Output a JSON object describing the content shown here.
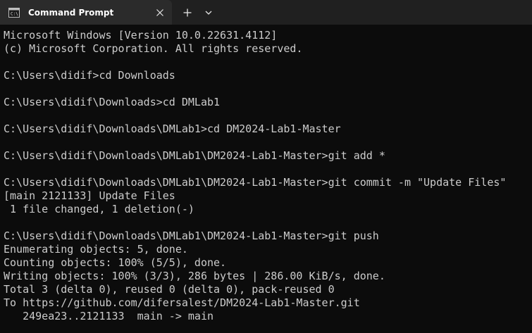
{
  "tab": {
    "title": "Command Prompt",
    "icon": "command-prompt-icon"
  },
  "tab_actions": {
    "close_icon": "close-icon",
    "new_tab_icon": "plus-icon",
    "dropdown_icon": "chevron-down-icon"
  },
  "terminal": {
    "lines": [
      "Microsoft Windows [Version 10.0.22631.4112]",
      "(c) Microsoft Corporation. All rights reserved.",
      "",
      "C:\\Users\\didif>cd Downloads",
      "",
      "C:\\Users\\didif\\Downloads>cd DMLab1",
      "",
      "C:\\Users\\didif\\Downloads\\DMLab1>cd DM2024-Lab1-Master",
      "",
      "C:\\Users\\didif\\Downloads\\DMLab1\\DM2024-Lab1-Master>git add *",
      "",
      "C:\\Users\\didif\\Downloads\\DMLab1\\DM2024-Lab1-Master>git commit -m \"Update Files\"",
      "[main 2121133] Update Files",
      " 1 file changed, 1 deletion(-)",
      "",
      "C:\\Users\\didif\\Downloads\\DMLab1\\DM2024-Lab1-Master>git push",
      "Enumerating objects: 5, done.",
      "Counting objects: 100% (5/5), done.",
      "Writing objects: 100% (3/3), 286 bytes | 286.00 KiB/s, done.",
      "Total 3 (delta 0), reused 0 (delta 0), pack-reused 0",
      "To https://github.com/difersalest/DM2024-Lab1-Master.git",
      "   249ea23..2121133  main -> main"
    ]
  },
  "colors": {
    "terminal_bg": "#0c0c0c",
    "terminal_fg": "#cccccc",
    "tabbar_bg": "#202020",
    "tab_active_bg": "#2b2b2b"
  }
}
